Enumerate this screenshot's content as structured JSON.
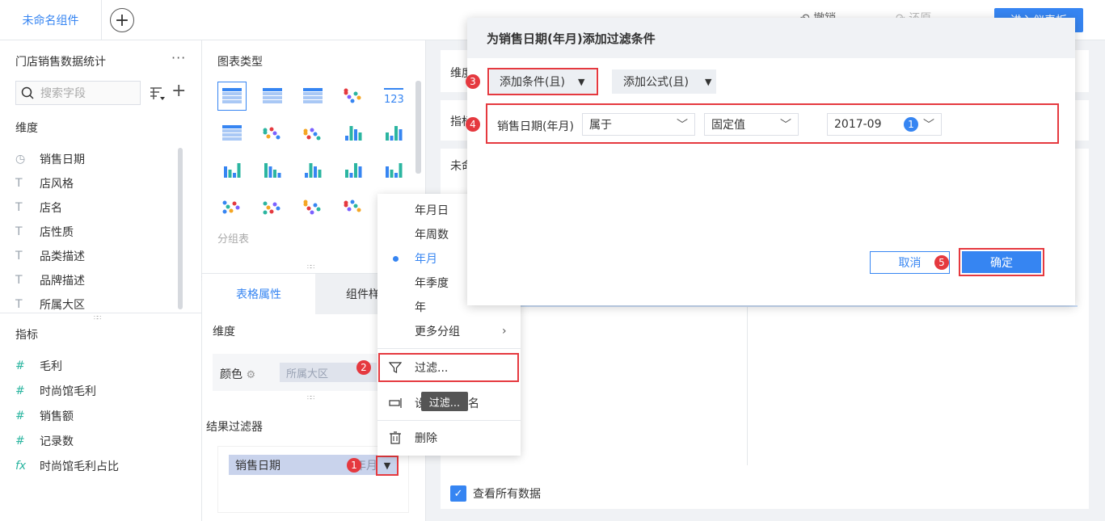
{
  "topbar": {
    "tab_label": "未命名组件",
    "add_tab": "+",
    "undo_label": "撤销",
    "redo_label": "还原",
    "dashboard_btn": "进入仪表板"
  },
  "left": {
    "dataset_title": "门店销售数据统计",
    "more": "···",
    "search_placeholder": "搜索字段",
    "dimension_label": "维度",
    "dimensions": [
      {
        "icon": "clock-icon",
        "glyph": "◷",
        "label": "销售日期"
      },
      {
        "icon": "text-icon",
        "glyph": "T",
        "label": "店风格"
      },
      {
        "icon": "text-icon",
        "glyph": "T",
        "label": "店名"
      },
      {
        "icon": "text-icon",
        "glyph": "T",
        "label": "店性质"
      },
      {
        "icon": "text-icon",
        "glyph": "T",
        "label": "品类描述"
      },
      {
        "icon": "text-icon",
        "glyph": "T",
        "label": "品牌描述"
      },
      {
        "icon": "text-icon",
        "glyph": "T",
        "label": "所属大区"
      }
    ],
    "measure_label": "指标",
    "measures": [
      {
        "icon": "number-icon",
        "glyph": "#",
        "label": "毛利"
      },
      {
        "icon": "number-calc-icon",
        "glyph": "#",
        "label": "时尚馆毛利"
      },
      {
        "icon": "number-icon",
        "glyph": "#",
        "label": "销售额"
      },
      {
        "icon": "record-count-icon",
        "glyph": "#",
        "label": "记录数"
      },
      {
        "icon": "formula-icon",
        "glyph": "fx",
        "label": "时尚馆毛利占比"
      }
    ]
  },
  "mid": {
    "chart_type_title": "图表类型",
    "group_table_label": "分组表",
    "tab_table_props": "表格属性",
    "tab_component": "组件样式",
    "dimension_label": "维度",
    "color_label": "颜色",
    "color_field": "所属大区",
    "result_filter_title": "结果过滤器",
    "filter_field": "销售日期",
    "filter_field_suffix": "年月"
  },
  "context_menu": {
    "items": [
      "年月日",
      "年周数",
      "年月",
      "年季度",
      "年"
    ],
    "selected": "年月",
    "more_group": "更多分组",
    "filter": "过滤...",
    "rename_prefix": "设",
    "rename_suffix": "名",
    "delete": "删除",
    "tooltip": "过滤..."
  },
  "right": {
    "dim_row": "维度",
    "measure_row": "指标",
    "table_title": "未命名",
    "view_all": "查看所有数据"
  },
  "dialog": {
    "title": "为销售日期(年月)添加过滤条件",
    "add_condition": "添加条件(且)",
    "add_formula": "添加公式(且)",
    "field_name": "销售日期(年月)",
    "operator": "属于",
    "value_type": "固定值",
    "value": "2017-09",
    "value_count": "1",
    "cancel": "取消",
    "ok": "确定"
  },
  "badges": [
    "1",
    "2",
    "3",
    "4",
    "5"
  ],
  "colors": {
    "accent": "#3685f2",
    "highlight_red": "#e5393f"
  }
}
